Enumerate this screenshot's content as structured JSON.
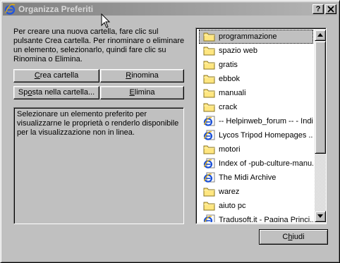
{
  "window": {
    "title": "Organizza Preferiti",
    "help_label": "?",
    "close_label": "✕"
  },
  "intro_text": "Per creare una nuova cartella, fare clic sul pulsante Crea cartella. Per rinominare o eliminare un elemento, selezionarlo, quindi fare clic su Rinomina o Elimina.",
  "buttons": {
    "create_folder": {
      "mnemonic": "C",
      "rest": "rea cartella"
    },
    "rename": {
      "mnemonic": "R",
      "rest": "inomina"
    },
    "move_to_folder": {
      "pre": "Sp",
      "mnemonic": "o",
      "rest": "sta nella cartella..."
    },
    "delete": {
      "mnemonic": "E",
      "rest": "limina"
    },
    "close": {
      "pre": "C",
      "mnemonic": "h",
      "rest": "iudi"
    }
  },
  "info_text": "Selezionare un elemento preferito per visualizzarne le proprietà o renderlo disponibile per la visualizzazione non in linea.",
  "favorites": [
    {
      "label": "programmazione",
      "icon": "folder-icon",
      "selected": true
    },
    {
      "label": "spazio web",
      "icon": "folder-icon"
    },
    {
      "label": "gratis",
      "icon": "folder-icon"
    },
    {
      "label": "ebbok",
      "icon": "folder-icon"
    },
    {
      "label": "manuali",
      "icon": "folder-icon"
    },
    {
      "label": "crack",
      "icon": "folder-icon"
    },
    {
      "label": "-- Helpinweb_forum -- - Indi...",
      "icon": "ie-link-icon"
    },
    {
      "label": "Lycos Tripod Homepages ...",
      "icon": "ie-link-icon"
    },
    {
      "label": "motori",
      "icon": "folder-icon"
    },
    {
      "label": "Index of -pub-culture-manu...",
      "icon": "ie-link-icon"
    },
    {
      "label": "The Midi Archive",
      "icon": "ie-link-icon"
    },
    {
      "label": "warez",
      "icon": "folder-icon"
    },
    {
      "label": "aiuto pc",
      "icon": "folder-icon"
    },
    {
      "label": "Tradusoft.it - Pagina Princi...",
      "icon": "ie-link-icon"
    }
  ],
  "colors": {
    "face": "#c0c0c0",
    "title_gradient_start": "#808080",
    "title_gradient_end": "#b5b5b5",
    "folder": "#ffe680",
    "ie_blue": "#1a4fd6"
  }
}
